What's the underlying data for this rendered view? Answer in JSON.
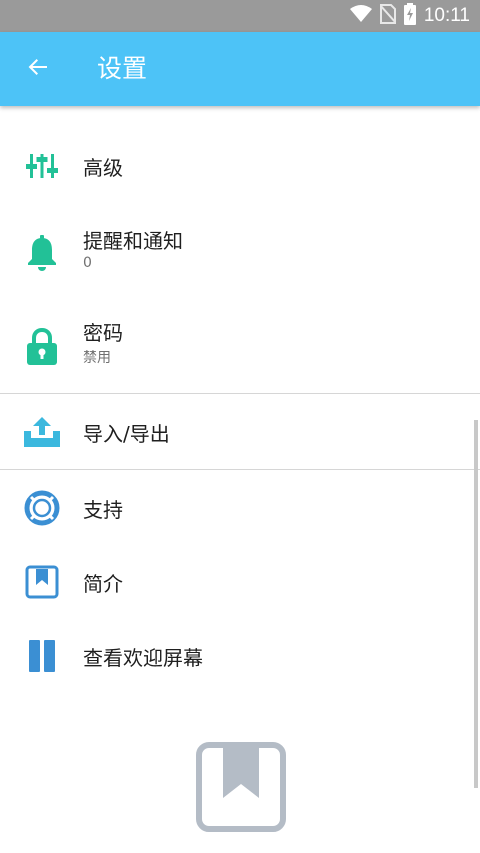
{
  "status_bar": {
    "time": "10:11",
    "icons": [
      "wifi-icon",
      "no-sim-icon",
      "battery-charging-icon"
    ]
  },
  "toolbar": {
    "title": "设置",
    "back_icon": "arrow-left-icon",
    "background_color": "#4dc3f7"
  },
  "settings": {
    "items": [
      {
        "label": "高级",
        "icon": "sliders-icon"
      },
      {
        "label": "提醒和通知",
        "subtitle": "0",
        "icon": "bell-icon"
      },
      {
        "label": "密码",
        "subtitle": "禁用",
        "icon": "lock-icon"
      },
      {
        "label": "导入/导出",
        "icon": "upload-tray-icon"
      },
      {
        "label": "支持",
        "icon": "lifebuoy-icon"
      },
      {
        "label": "简介",
        "icon": "bookmark-book-icon"
      },
      {
        "label": "查看欢迎屏幕",
        "icon": "pause-columns-icon"
      }
    ]
  },
  "colors": {
    "accent_green": "#22c197",
    "accent_blue": "#3b8fd3",
    "logo_gray": "#b4bcc6"
  }
}
